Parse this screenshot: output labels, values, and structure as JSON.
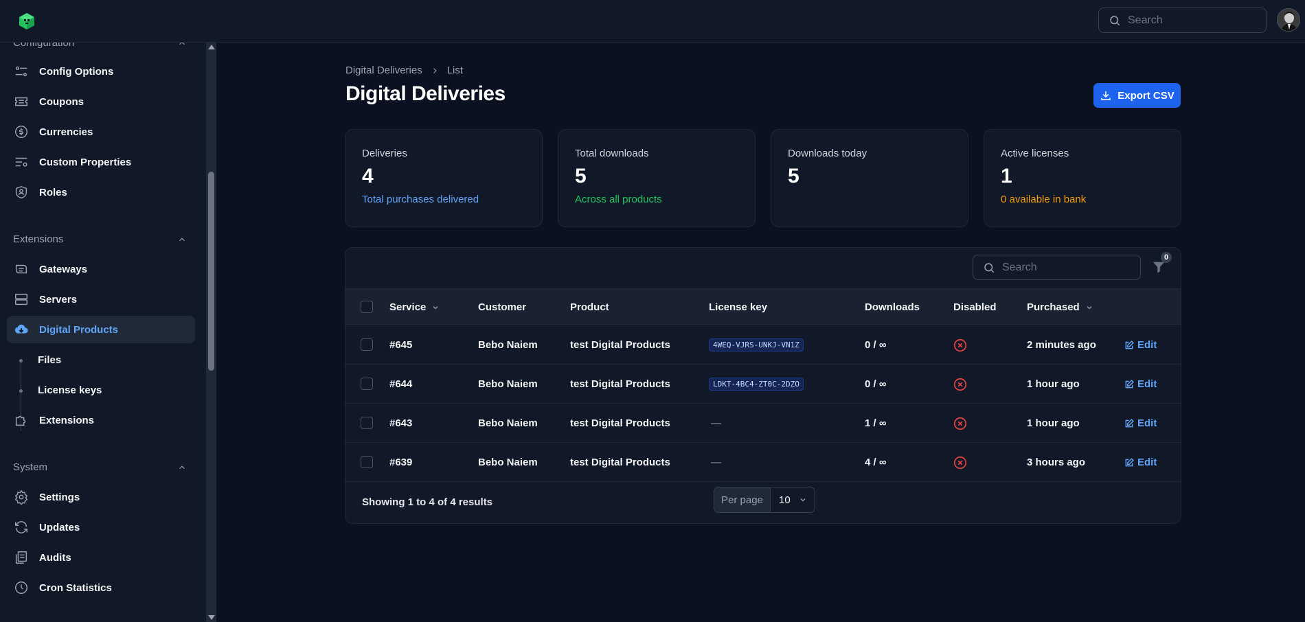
{
  "topbar": {
    "search_placeholder": "Search"
  },
  "sidebar": {
    "groups": {
      "configuration": {
        "title": "Configuration"
      },
      "extensions": {
        "title": "Extensions"
      },
      "system": {
        "title": "System"
      }
    },
    "items": {
      "config_options": "Config Options",
      "coupons": "Coupons",
      "currencies": "Currencies",
      "custom_properties": "Custom Properties",
      "roles": "Roles",
      "gateways": "Gateways",
      "servers": "Servers",
      "digital_products": "Digital Products",
      "files": "Files",
      "license_keys": "License keys",
      "extensions": "Extensions",
      "settings": "Settings",
      "updates": "Updates",
      "audits": "Audits",
      "cron_statistics": "Cron Statistics"
    }
  },
  "breadcrumb": {
    "parent": "Digital Deliveries",
    "current": "List"
  },
  "page": {
    "title": "Digital Deliveries",
    "export_label": "Export CSV"
  },
  "stats": [
    {
      "label": "Deliveries",
      "value": "4",
      "sub": "Total purchases delivered",
      "sub_color": "#60a5fa"
    },
    {
      "label": "Total downloads",
      "value": "5",
      "sub": "Across all products",
      "sub_color": "#22c55e"
    },
    {
      "label": "Downloads today",
      "value": "5",
      "sub": "",
      "sub_color": "#9ca3af"
    },
    {
      "label": "Active licenses",
      "value": "1",
      "sub": "0 available in bank",
      "sub_color": "#f59e0b"
    }
  ],
  "table": {
    "search_placeholder": "Search",
    "filter_count": "0",
    "columns": {
      "service": "Service",
      "customer": "Customer",
      "product": "Product",
      "license_key": "License key",
      "downloads": "Downloads",
      "disabled": "Disabled",
      "purchased": "Purchased"
    },
    "rows": [
      {
        "service": "#645",
        "customer": "Bebo Naiem",
        "product": "test Digital Products",
        "license_key": "4WEQ-VJRS-UNKJ-VN1Z",
        "downloads": "0 / ∞",
        "purchased": "2 minutes ago",
        "edit": "Edit"
      },
      {
        "service": "#644",
        "customer": "Bebo Naiem",
        "product": "test Digital Products",
        "license_key": "LDKT-4BC4-ZT0C-2DZO",
        "downloads": "0 / ∞",
        "purchased": "1 hour ago",
        "edit": "Edit"
      },
      {
        "service": "#643",
        "customer": "Bebo Naiem",
        "product": "test Digital Products",
        "license_key": "—",
        "downloads": "1 / ∞",
        "purchased": "1 hour ago",
        "edit": "Edit"
      },
      {
        "service": "#639",
        "customer": "Bebo Naiem",
        "product": "test Digital Products",
        "license_key": "—",
        "downloads": "4 / ∞",
        "purchased": "3 hours ago",
        "edit": "Edit"
      }
    ],
    "footer": {
      "showing": "Showing 1 to 4 of 4 results",
      "per_page_label": "Per page",
      "per_page_value": "10"
    }
  },
  "colors": {
    "accent": "#1d63ed",
    "link": "#60a5fa",
    "danger": "#ef4444"
  }
}
